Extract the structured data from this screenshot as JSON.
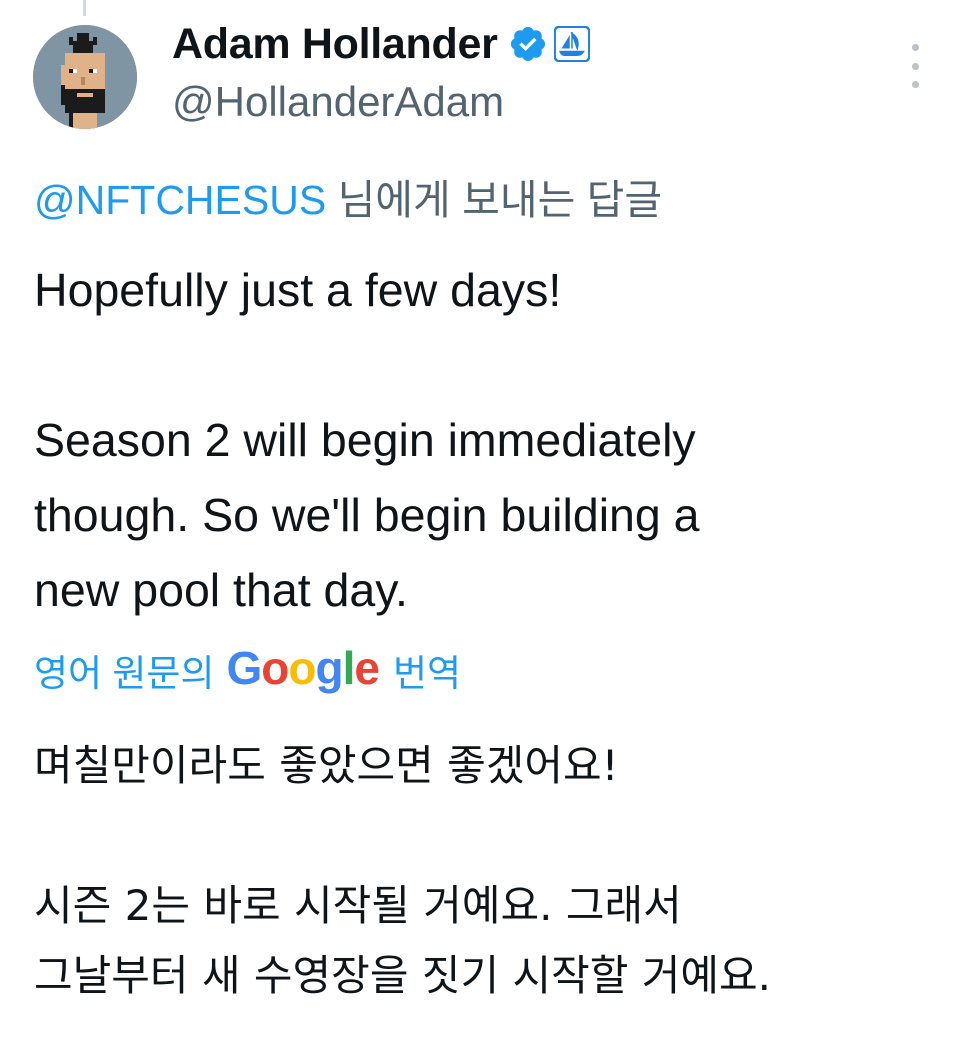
{
  "tweet": {
    "author": {
      "display_name": "Adam Hollander",
      "handle": "@HollanderAdam",
      "avatar_icon": "pixel-punk-avatar",
      "badges": [
        "verified-badge-icon",
        "opensea-badge-icon"
      ]
    },
    "reply_to": {
      "mention": "@NFTCHESUS",
      "suffix": " 님에게 보내는 답글"
    },
    "text_lines": [
      "Hopefully just a few days!",
      "",
      "Season 2 will begin immediately",
      "though. So we'll begin building a",
      "new pool that day."
    ],
    "translation": {
      "prefix": "영어 원문의",
      "logo": {
        "g1": "G",
        "o1": "o",
        "o2": "o",
        "g2": "g",
        "l": "l",
        "e": "e"
      },
      "suffix": "번역",
      "text_lines": [
        "며칠만이라도 좋았으면 좋겠어요!",
        "",
        "시즌 2는 바로 시작될 거예요. 그래서",
        "그날부터 새 수영장을 짓기 시작할 거예요."
      ]
    },
    "more_icon": "more-vertical-icon"
  },
  "colors": {
    "link": "#1d9bf0",
    "secondary_text": "#536471",
    "primary_text": "#0f1419",
    "verified": "#1d9bf0",
    "opensea": "#2081e2"
  }
}
